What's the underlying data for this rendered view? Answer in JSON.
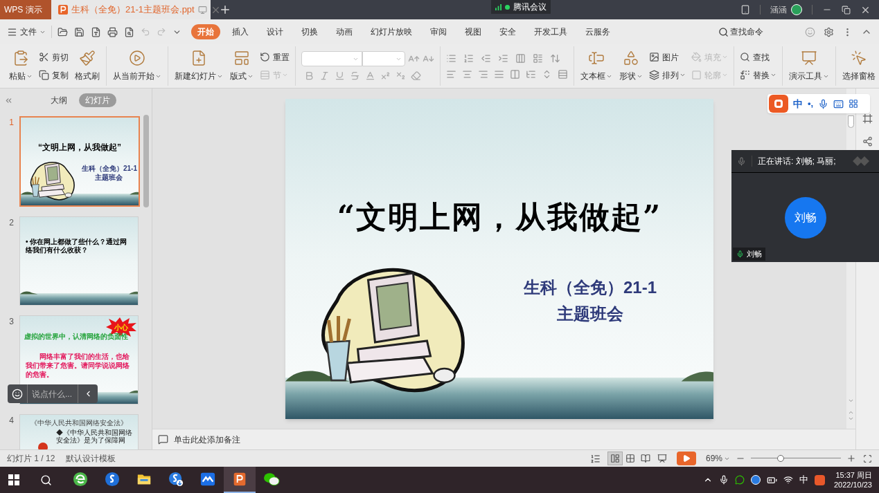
{
  "title_bar": {
    "app_tab": "WPS 演示",
    "doc_tabs": [
      {
        "label": "生科（全免）21-1主题班会.ppt",
        "selected": true
      }
    ],
    "meeting": "腾讯会议",
    "user": "涵涵"
  },
  "menu_bar": {
    "file": "文件",
    "tabs": [
      {
        "label": "开始",
        "selected": true
      },
      {
        "label": "插入",
        "selected": false
      },
      {
        "label": "设计",
        "selected": false
      },
      {
        "label": "切换",
        "selected": false
      },
      {
        "label": "动画",
        "selected": false
      },
      {
        "label": "幻灯片放映",
        "selected": false
      },
      {
        "label": "审阅",
        "selected": false
      },
      {
        "label": "视图",
        "selected": false
      },
      {
        "label": "安全",
        "selected": false
      },
      {
        "label": "开发工具",
        "selected": false
      },
      {
        "label": "云服务",
        "selected": false
      }
    ],
    "search": "查找命令"
  },
  "ribbon": {
    "groups": [
      {
        "kind": "buttons",
        "columns": [
          [
            {
              "label": "粘贴",
              "dropdown": true,
              "disabled": false
            }
          ],
          [
            {
              "label": "剪切",
              "dropdown": false,
              "disabled": false
            },
            {
              "label": "复制",
              "dropdown": false,
              "disabled": false
            }
          ],
          [
            {
              "label": "格式刷",
              "dropdown": false,
              "disabled": false
            }
          ]
        ]
      },
      {
        "kind": "buttons",
        "columns": [
          [
            {
              "label": "从当前开始",
              "dropdown": true,
              "disabled": false
            }
          ]
        ]
      },
      {
        "kind": "buttons",
        "columns": [
          [
            {
              "label": "新建幻灯片",
              "dropdown": true,
              "disabled": false
            }
          ],
          [
            {
              "label": "版式",
              "dropdown": true,
              "disabled": false
            }
          ],
          [
            {
              "label": "重置",
              "dropdown": false,
              "disabled": false
            },
            {
              "label": "节",
              "dropdown": true,
              "disabled": true
            }
          ]
        ]
      },
      {
        "kind": "font"
      },
      {
        "kind": "paragraph"
      },
      {
        "kind": "buttons",
        "columns": [
          [
            {
              "label": "文本框",
              "dropdown": true,
              "disabled": false
            }
          ],
          [
            {
              "label": "形状",
              "dropdown": true,
              "disabled": false
            }
          ],
          [
            {
              "label": "图片",
              "dropdown": false,
              "disabled": false
            },
            {
              "label": "排列",
              "dropdown": true,
              "disabled": false
            }
          ],
          [
            {
              "label": "填充",
              "dropdown": true,
              "disabled": true
            },
            {
              "label": "轮廓",
              "dropdown": true,
              "disabled": true
            }
          ]
        ]
      },
      {
        "kind": "buttons",
        "columns": [
          [
            {
              "label": "查找",
              "dropdown": false,
              "disabled": false
            },
            {
              "label": "替换",
              "dropdown": true,
              "disabled": false
            }
          ]
        ]
      },
      {
        "kind": "buttons",
        "columns": [
          [
            {
              "label": "演示工具",
              "dropdown": true,
              "disabled": false
            }
          ]
        ]
      },
      {
        "kind": "buttons",
        "columns": [
          [
            {
              "label": "选择窗格",
              "dropdown": false,
              "disabled": false
            }
          ]
        ]
      }
    ]
  },
  "slide_panel": {
    "view_tabs": [
      {
        "label": "大纲",
        "selected": false
      },
      {
        "label": "幻灯片",
        "selected": true
      }
    ],
    "slides": [
      {
        "number": "1",
        "selected": true,
        "kind": "cover",
        "texts": [
          {
            "kind": "title",
            "text": "“文明上网，从我做起”"
          },
          {
            "kind": "subtitle",
            "text": "生科（全免）21-1"
          },
          {
            "kind": "subtitle",
            "text": "主题班会"
          }
        ]
      },
      {
        "number": "2",
        "selected": false,
        "kind": "content",
        "texts": [
          {
            "kind": "bullet",
            "text": "• 你在网上都做了些什么？通过网络我们有什么收获？"
          }
        ]
      },
      {
        "number": "3",
        "selected": false,
        "kind": "content",
        "texts": [
          {
            "kind": "burst",
            "text": "小心"
          },
          {
            "kind": "green",
            "text": "虚拟的世界中，认清网络的负面性"
          },
          {
            "kind": "red",
            "text": "网络丰富了我们的生活，也给我们带来了危害。请同学说说网络的危害。"
          }
        ]
      },
      {
        "number": "4",
        "selected": false,
        "kind": "law",
        "texts": [
          {
            "kind": "heading",
            "text": "《中华人民共和国网络安全法》"
          },
          {
            "kind": "note",
            "text": "◆《中华人民共和国网络安全法》是为了保障网"
          }
        ]
      }
    ]
  },
  "slide": {
    "title": "“文明上网，从我做起”",
    "subtitle": [
      "生科（全免）21-1",
      "主题班会"
    ]
  },
  "notes": {
    "placeholder": "单击此处添加备注"
  },
  "chat": {
    "placeholder": "说点什么..."
  },
  "ime_bar": {
    "mode": "中",
    "punctuation": "•,"
  },
  "meeting_panel": {
    "speaking": "正在讲话: 刘畅; 马丽;",
    "participant": "刘畅",
    "label": "刘畅"
  },
  "status_bar": {
    "slide_counter": "幻灯片 1 / 12",
    "template": "默认设计模板",
    "views": [
      {
        "selected": true
      },
      {
        "selected": false
      },
      {
        "selected": false
      }
    ],
    "zoom": "69%",
    "zoom_slider": {
      "level": 0.33
    }
  },
  "taskbar": {
    "apps": [
      {
        "selected": false
      },
      {
        "selected": false
      },
      {
        "selected": false
      },
      {
        "selected": false
      },
      {
        "selected": false
      },
      {
        "selected": true
      },
      {
        "selected": false
      }
    ],
    "ime": "中",
    "time": "15:37 周日",
    "date": "2022/10/23"
  }
}
